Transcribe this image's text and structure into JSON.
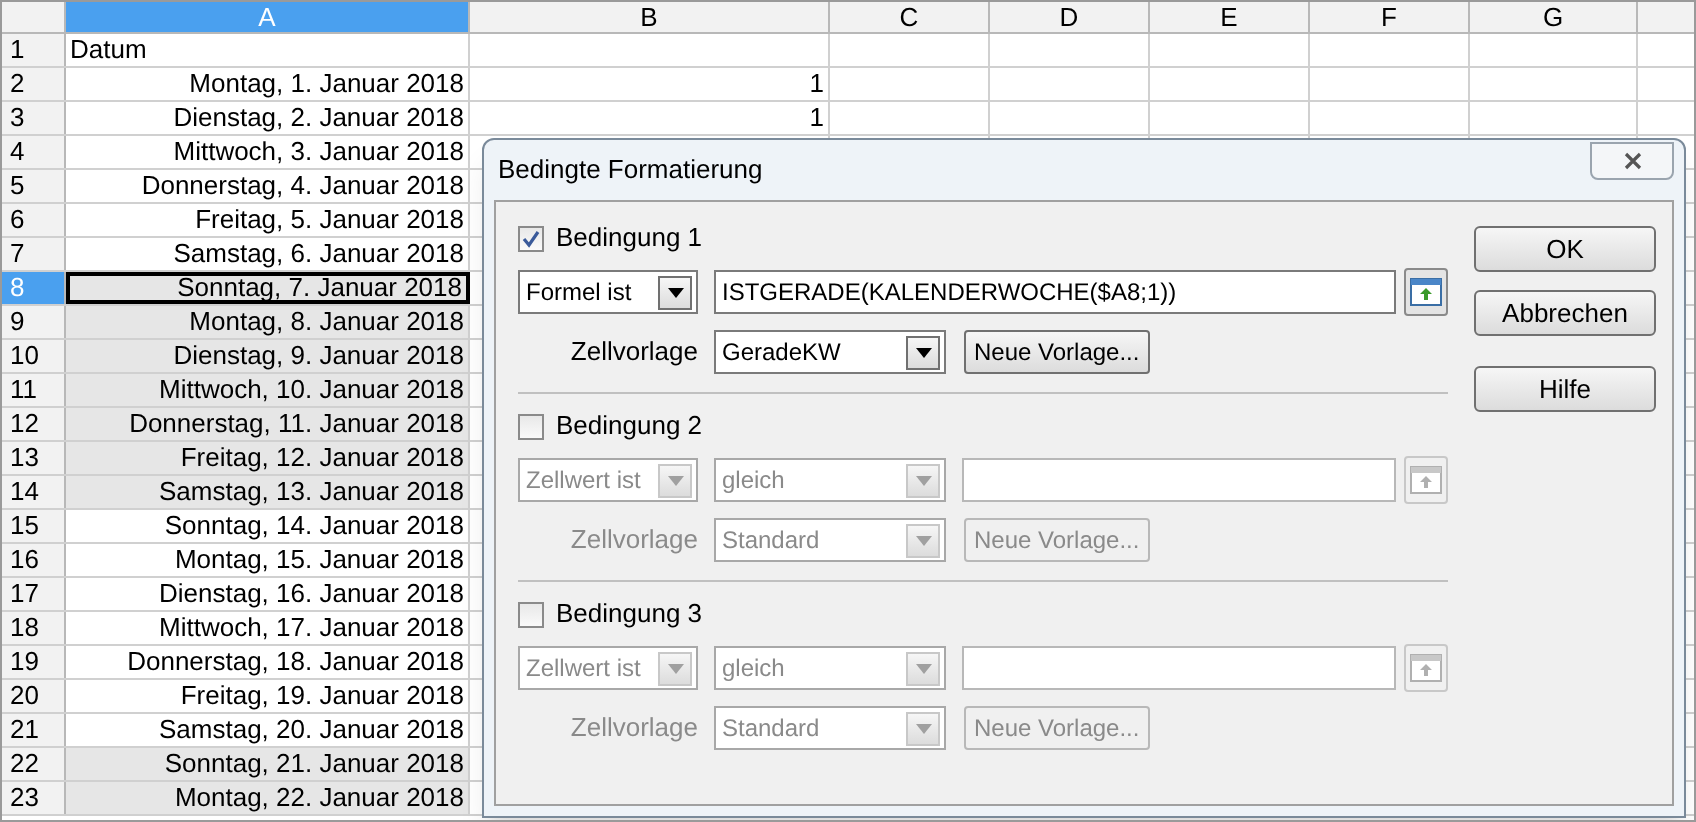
{
  "columns": [
    {
      "label": "A",
      "selected": true
    },
    {
      "label": "B",
      "selected": false
    },
    {
      "label": "C",
      "selected": false
    },
    {
      "label": "D",
      "selected": false
    },
    {
      "label": "E",
      "selected": false
    },
    {
      "label": "F",
      "selected": false
    },
    {
      "label": "G",
      "selected": false
    }
  ],
  "rows": [
    {
      "number": "1",
      "a": "Datum",
      "b": "",
      "shaded": false,
      "selected": false,
      "kind": "header"
    },
    {
      "number": "2",
      "a": "Montag, 1. Januar 2018",
      "b": "1",
      "shaded": false,
      "selected": false
    },
    {
      "number": "3",
      "a": "Dienstag, 2. Januar 2018",
      "b": "1",
      "shaded": false,
      "selected": false
    },
    {
      "number": "4",
      "a": "Mittwoch, 3. Januar 2018",
      "b": "",
      "shaded": false,
      "selected": false
    },
    {
      "number": "5",
      "a": "Donnerstag, 4. Januar 2018",
      "b": "",
      "shaded": false,
      "selected": false
    },
    {
      "number": "6",
      "a": "Freitag, 5. Januar 2018",
      "b": "",
      "shaded": false,
      "selected": false
    },
    {
      "number": "7",
      "a": "Samstag, 6. Januar 2018",
      "b": "",
      "shaded": false,
      "selected": false
    },
    {
      "number": "8",
      "a": "Sonntag, 7. Januar 2018",
      "b": "",
      "shaded": true,
      "selected": true
    },
    {
      "number": "9",
      "a": "Montag, 8. Januar 2018",
      "b": "",
      "shaded": true,
      "selected": false
    },
    {
      "number": "10",
      "a": "Dienstag, 9. Januar 2018",
      "b": "",
      "shaded": true,
      "selected": false
    },
    {
      "number": "11",
      "a": "Mittwoch, 10. Januar 2018",
      "b": "",
      "shaded": true,
      "selected": false
    },
    {
      "number": "12",
      "a": "Donnerstag, 11. Januar 2018",
      "b": "",
      "shaded": true,
      "selected": false
    },
    {
      "number": "13",
      "a": "Freitag, 12. Januar 2018",
      "b": "",
      "shaded": true,
      "selected": false
    },
    {
      "number": "14",
      "a": "Samstag, 13. Januar 2018",
      "b": "",
      "shaded": true,
      "selected": false
    },
    {
      "number": "15",
      "a": "Sonntag, 14. Januar 2018",
      "b": "",
      "shaded": false,
      "selected": false
    },
    {
      "number": "16",
      "a": "Montag, 15. Januar 2018",
      "b": "",
      "shaded": false,
      "selected": false
    },
    {
      "number": "17",
      "a": "Dienstag, 16. Januar 2018",
      "b": "",
      "shaded": false,
      "selected": false
    },
    {
      "number": "18",
      "a": "Mittwoch, 17. Januar 2018",
      "b": "",
      "shaded": false,
      "selected": false
    },
    {
      "number": "19",
      "a": "Donnerstag, 18. Januar 2018",
      "b": "",
      "shaded": false,
      "selected": false
    },
    {
      "number": "20",
      "a": "Freitag, 19. Januar 2018",
      "b": "",
      "shaded": false,
      "selected": false
    },
    {
      "number": "21",
      "a": "Samstag, 20. Januar 2018",
      "b": "",
      "shaded": false,
      "selected": false
    },
    {
      "number": "22",
      "a": "Sonntag, 21. Januar 2018",
      "b": "",
      "shaded": true,
      "selected": false
    },
    {
      "number": "23",
      "a": "Montag, 22. Januar 2018",
      "b": "",
      "shaded": true,
      "selected": false
    }
  ],
  "dialog": {
    "title": "Bedingte Formatierung",
    "conditions": [
      {
        "label": "Bedingung 1",
        "checked": true,
        "kind": "formula",
        "condition": "Formel ist",
        "value": "ISTGERADE(KALENDERWOCHE($A8;1))",
        "style_label": "Zellvorlage",
        "style": "GeradeKW",
        "new_style": "Neue Vorlage..."
      },
      {
        "label": "Bedingung 2",
        "checked": false,
        "kind": "cell_value",
        "condition": "Zellwert ist",
        "operator": "gleich",
        "style_label": "Zellvorlage",
        "style": "Standard",
        "new_style": "Neue Vorlage..."
      },
      {
        "label": "Bedingung 3",
        "checked": false,
        "kind": "cell_value",
        "condition": "Zellwert ist",
        "operator": "gleich",
        "style_label": "Zellvorlage",
        "style": "Standard",
        "new_style": "Neue Vorlage..."
      }
    ],
    "buttons": [
      "OK",
      "Abbrechen",
      "Hilfe"
    ]
  }
}
